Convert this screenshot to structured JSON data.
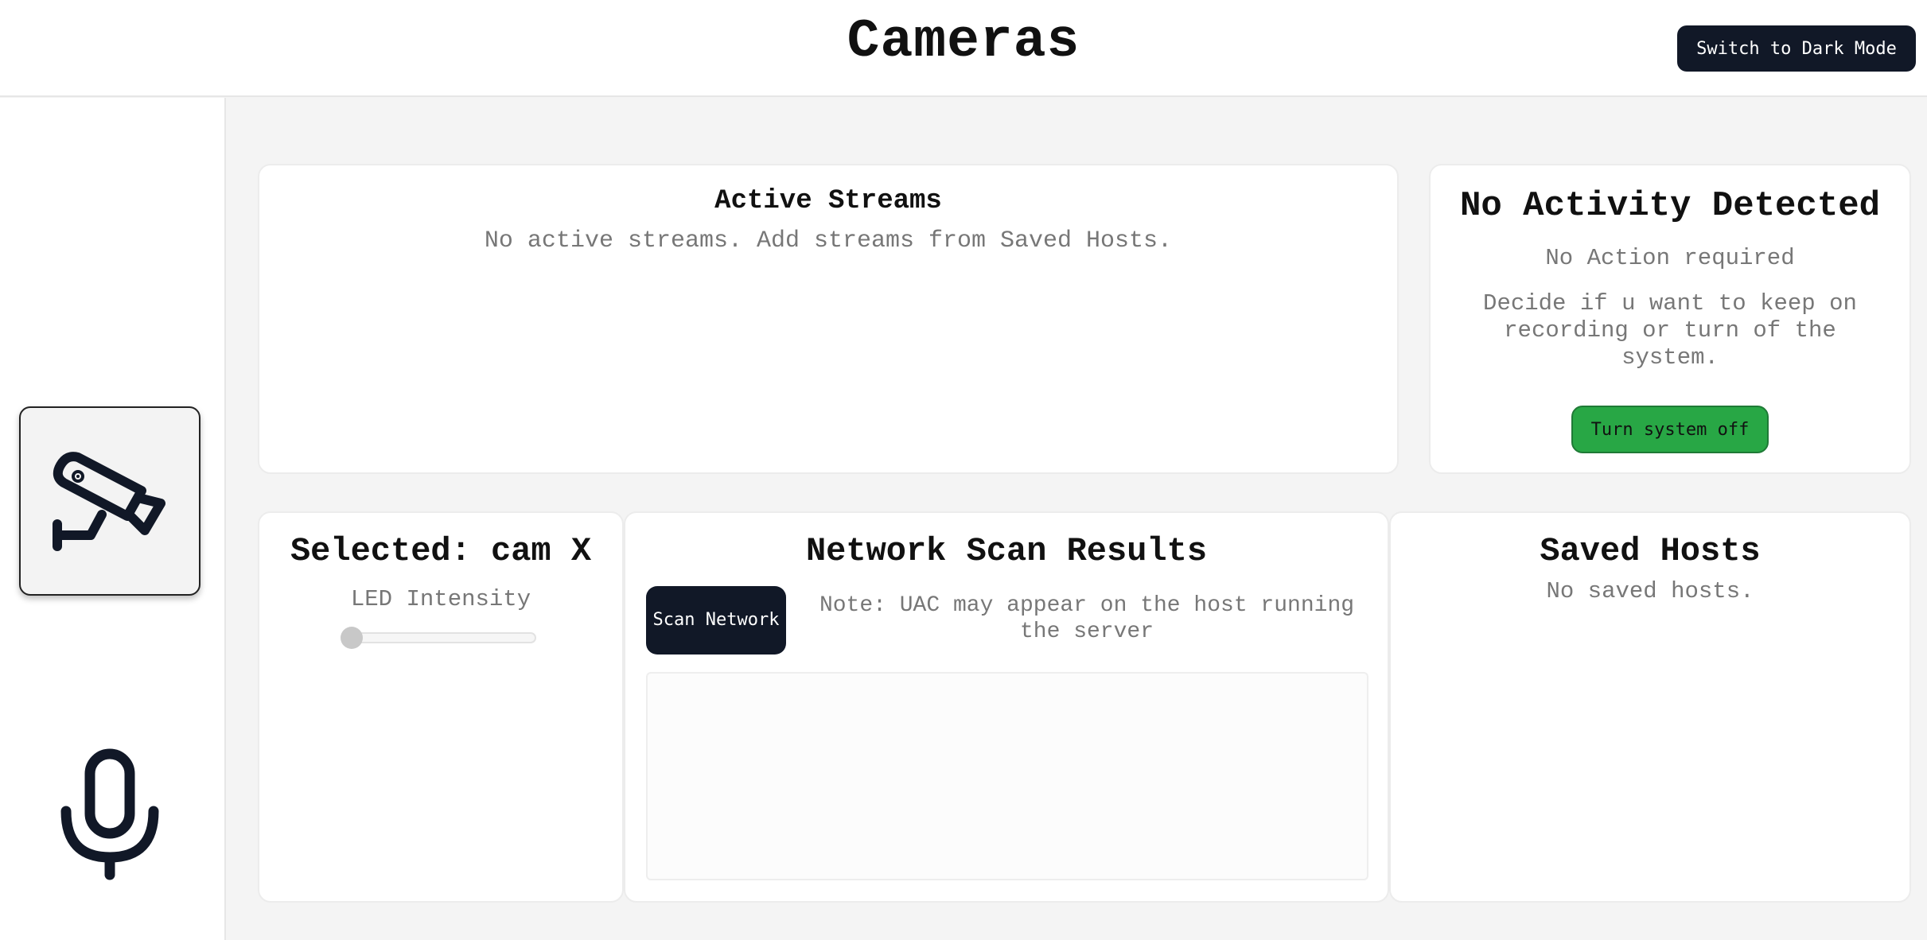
{
  "header": {
    "title": "Cameras",
    "theme_button_label": "Switch to Dark Mode"
  },
  "sidebar": {
    "items": [
      {
        "name": "camera",
        "icon": "security-camera-icon",
        "selected": true
      },
      {
        "name": "microphone",
        "icon": "microphone-icon",
        "selected": false
      }
    ]
  },
  "active_streams": {
    "title": "Active Streams",
    "empty_message": "No active streams. Add streams from Saved Hosts."
  },
  "activity": {
    "title": "No Activity Detected",
    "subtitle": "No Action required",
    "message": "Decide if u want to keep on recording or turn of the system.",
    "button_label": "Turn system off"
  },
  "selected_camera": {
    "title": "Selected: cam X",
    "slider_label": "LED Intensity",
    "slider_value": 0
  },
  "network_scan": {
    "title": "Network Scan Results",
    "scan_button_label": "Scan Network",
    "note": "Note: UAC may appear on the host running the server"
  },
  "saved_hosts": {
    "title": "Saved Hosts",
    "empty_message": "No saved hosts."
  },
  "colors": {
    "primary_dark": "#111827",
    "success": "#28a745",
    "background": "#f4f4f4",
    "muted_text": "#777777"
  }
}
